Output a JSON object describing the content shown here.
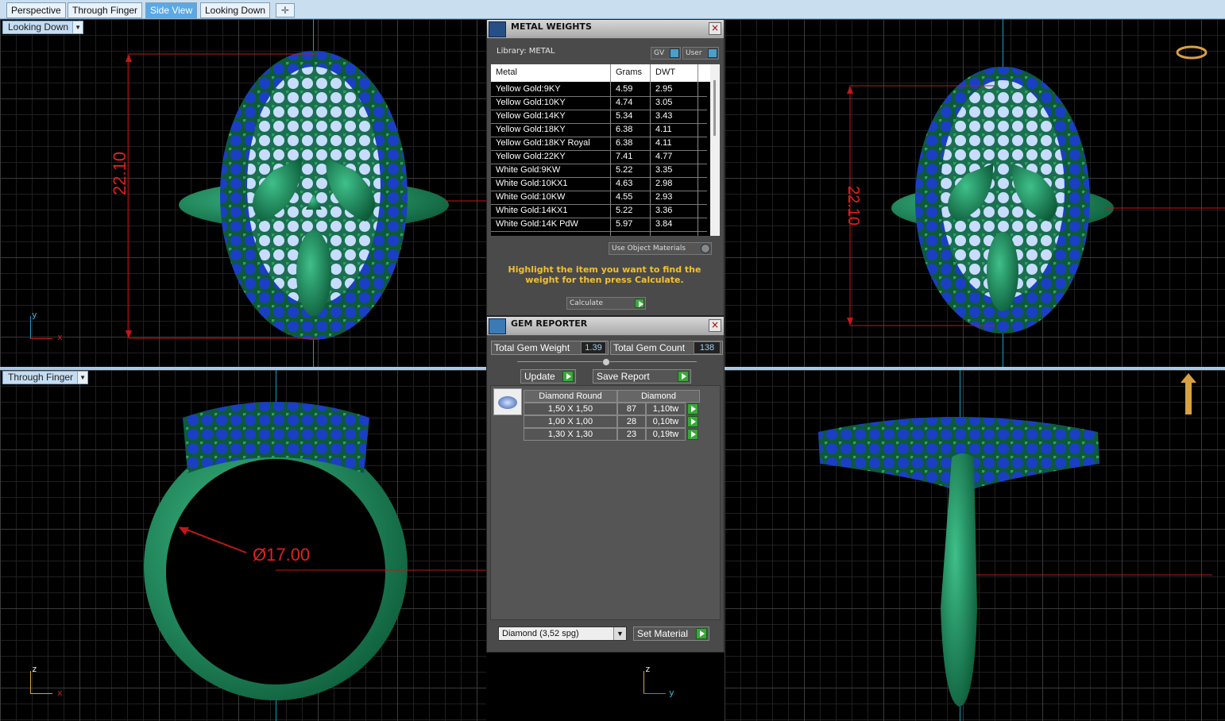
{
  "tabs": [
    {
      "label": "Perspective",
      "active": false
    },
    {
      "label": "Through Finger",
      "active": false
    },
    {
      "label": "Side View",
      "active": true
    },
    {
      "label": "Looking Down",
      "active": false
    }
  ],
  "add_tab_icon": "plus-icon",
  "viewports": {
    "top_left_label": "Looking Down",
    "bottom_left_label": "Through Finger",
    "dim_top_left": "22.10",
    "dim_top_right": "22.10",
    "dim_bottom_left": "Ø17.00",
    "triad_tl": {
      "v": "y",
      "h": "x"
    },
    "triad_bl": {
      "v": "z",
      "h": "x"
    },
    "triad_br": {
      "v": "z",
      "h": "y"
    }
  },
  "metal_weights": {
    "title": "METAL WEIGHTS",
    "library": "Library: METAL",
    "toggle_gv": "GV",
    "toggle_user": "User",
    "columns": [
      "Metal",
      "Grams",
      "DWT"
    ],
    "rows": [
      {
        "metal": "Yellow Gold:9KY",
        "grams": "4.59",
        "dwt": "2.95"
      },
      {
        "metal": "Yellow Gold:10KY",
        "grams": "4.74",
        "dwt": "3.05"
      },
      {
        "metal": "Yellow Gold:14KY",
        "grams": "5.34",
        "dwt": "3.43"
      },
      {
        "metal": "Yellow Gold:18KY",
        "grams": "6.38",
        "dwt": "4.11"
      },
      {
        "metal": "Yellow Gold:18KY Royal",
        "grams": "6.38",
        "dwt": "4.11"
      },
      {
        "metal": "Yellow Gold:22KY",
        "grams": "7.41",
        "dwt": "4.77"
      },
      {
        "metal": "White Gold:9KW",
        "grams": "5.22",
        "dwt": "3.35"
      },
      {
        "metal": "White Gold:10KX1",
        "grams": "4.63",
        "dwt": "2.98"
      },
      {
        "metal": "White Gold:10KW",
        "grams": "4.55",
        "dwt": "2.93"
      },
      {
        "metal": "White Gold:14KX1",
        "grams": "5.22",
        "dwt": "3.36"
      },
      {
        "metal": "White Gold:14K PdW",
        "grams": "5.97",
        "dwt": "3.84"
      }
    ],
    "use_object_materials": "Use Object Materials",
    "hint": "Highlight the item you want to find the weight for then press Calculate.",
    "calculate": "Calculate"
  },
  "gem_reporter": {
    "title": "GEM REPORTER",
    "total_weight_label": "Total Gem Weight",
    "total_weight_value": "1.39",
    "total_count_label": "Total Gem Count",
    "total_count_value": "138",
    "update": "Update",
    "save_report": "Save Report",
    "head_shape": "Diamond Round",
    "head_material": "Diamond",
    "gems": [
      {
        "size": "1,50 X 1,50",
        "count": "87",
        "weight": "1,10tw"
      },
      {
        "size": "1,00 X 1,00",
        "count": "28",
        "weight": "0,10tw"
      },
      {
        "size": "1,30 X 1,30",
        "count": "23",
        "weight": "0,19tw"
      }
    ],
    "material_select": "Diamond     (3,52 spg)",
    "set_material": "Set Material"
  },
  "colors": {
    "metal_green": "#1e8a5a",
    "gem_blue": "#1f3fc8",
    "gem_white": "#cfe0ff",
    "dimension_red": "#e02020"
  }
}
